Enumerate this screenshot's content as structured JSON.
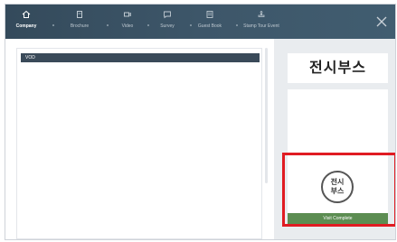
{
  "nav": {
    "items": [
      {
        "label": "Company",
        "icon": "home-icon"
      },
      {
        "label": "Brochure",
        "icon": "document-icon"
      },
      {
        "label": "Video",
        "icon": "video-icon"
      },
      {
        "label": "Survey",
        "icon": "survey-icon"
      },
      {
        "label": "Guest Book",
        "icon": "guestbook-icon"
      },
      {
        "label": "Stamp Tour Event",
        "icon": "stamp-tour-icon"
      }
    ],
    "active": "Company",
    "close_icon": "close-icon"
  },
  "content": {
    "vod_label": "VOD"
  },
  "booth": {
    "title": "전시부스",
    "stamp_text": "전시 부스",
    "button_label": "Visit Complete"
  },
  "colors": {
    "nav_bg": "#3d5669",
    "highlight": "#e01b22",
    "button": "#5c8d52",
    "panel_bg": "#e9ecef"
  }
}
